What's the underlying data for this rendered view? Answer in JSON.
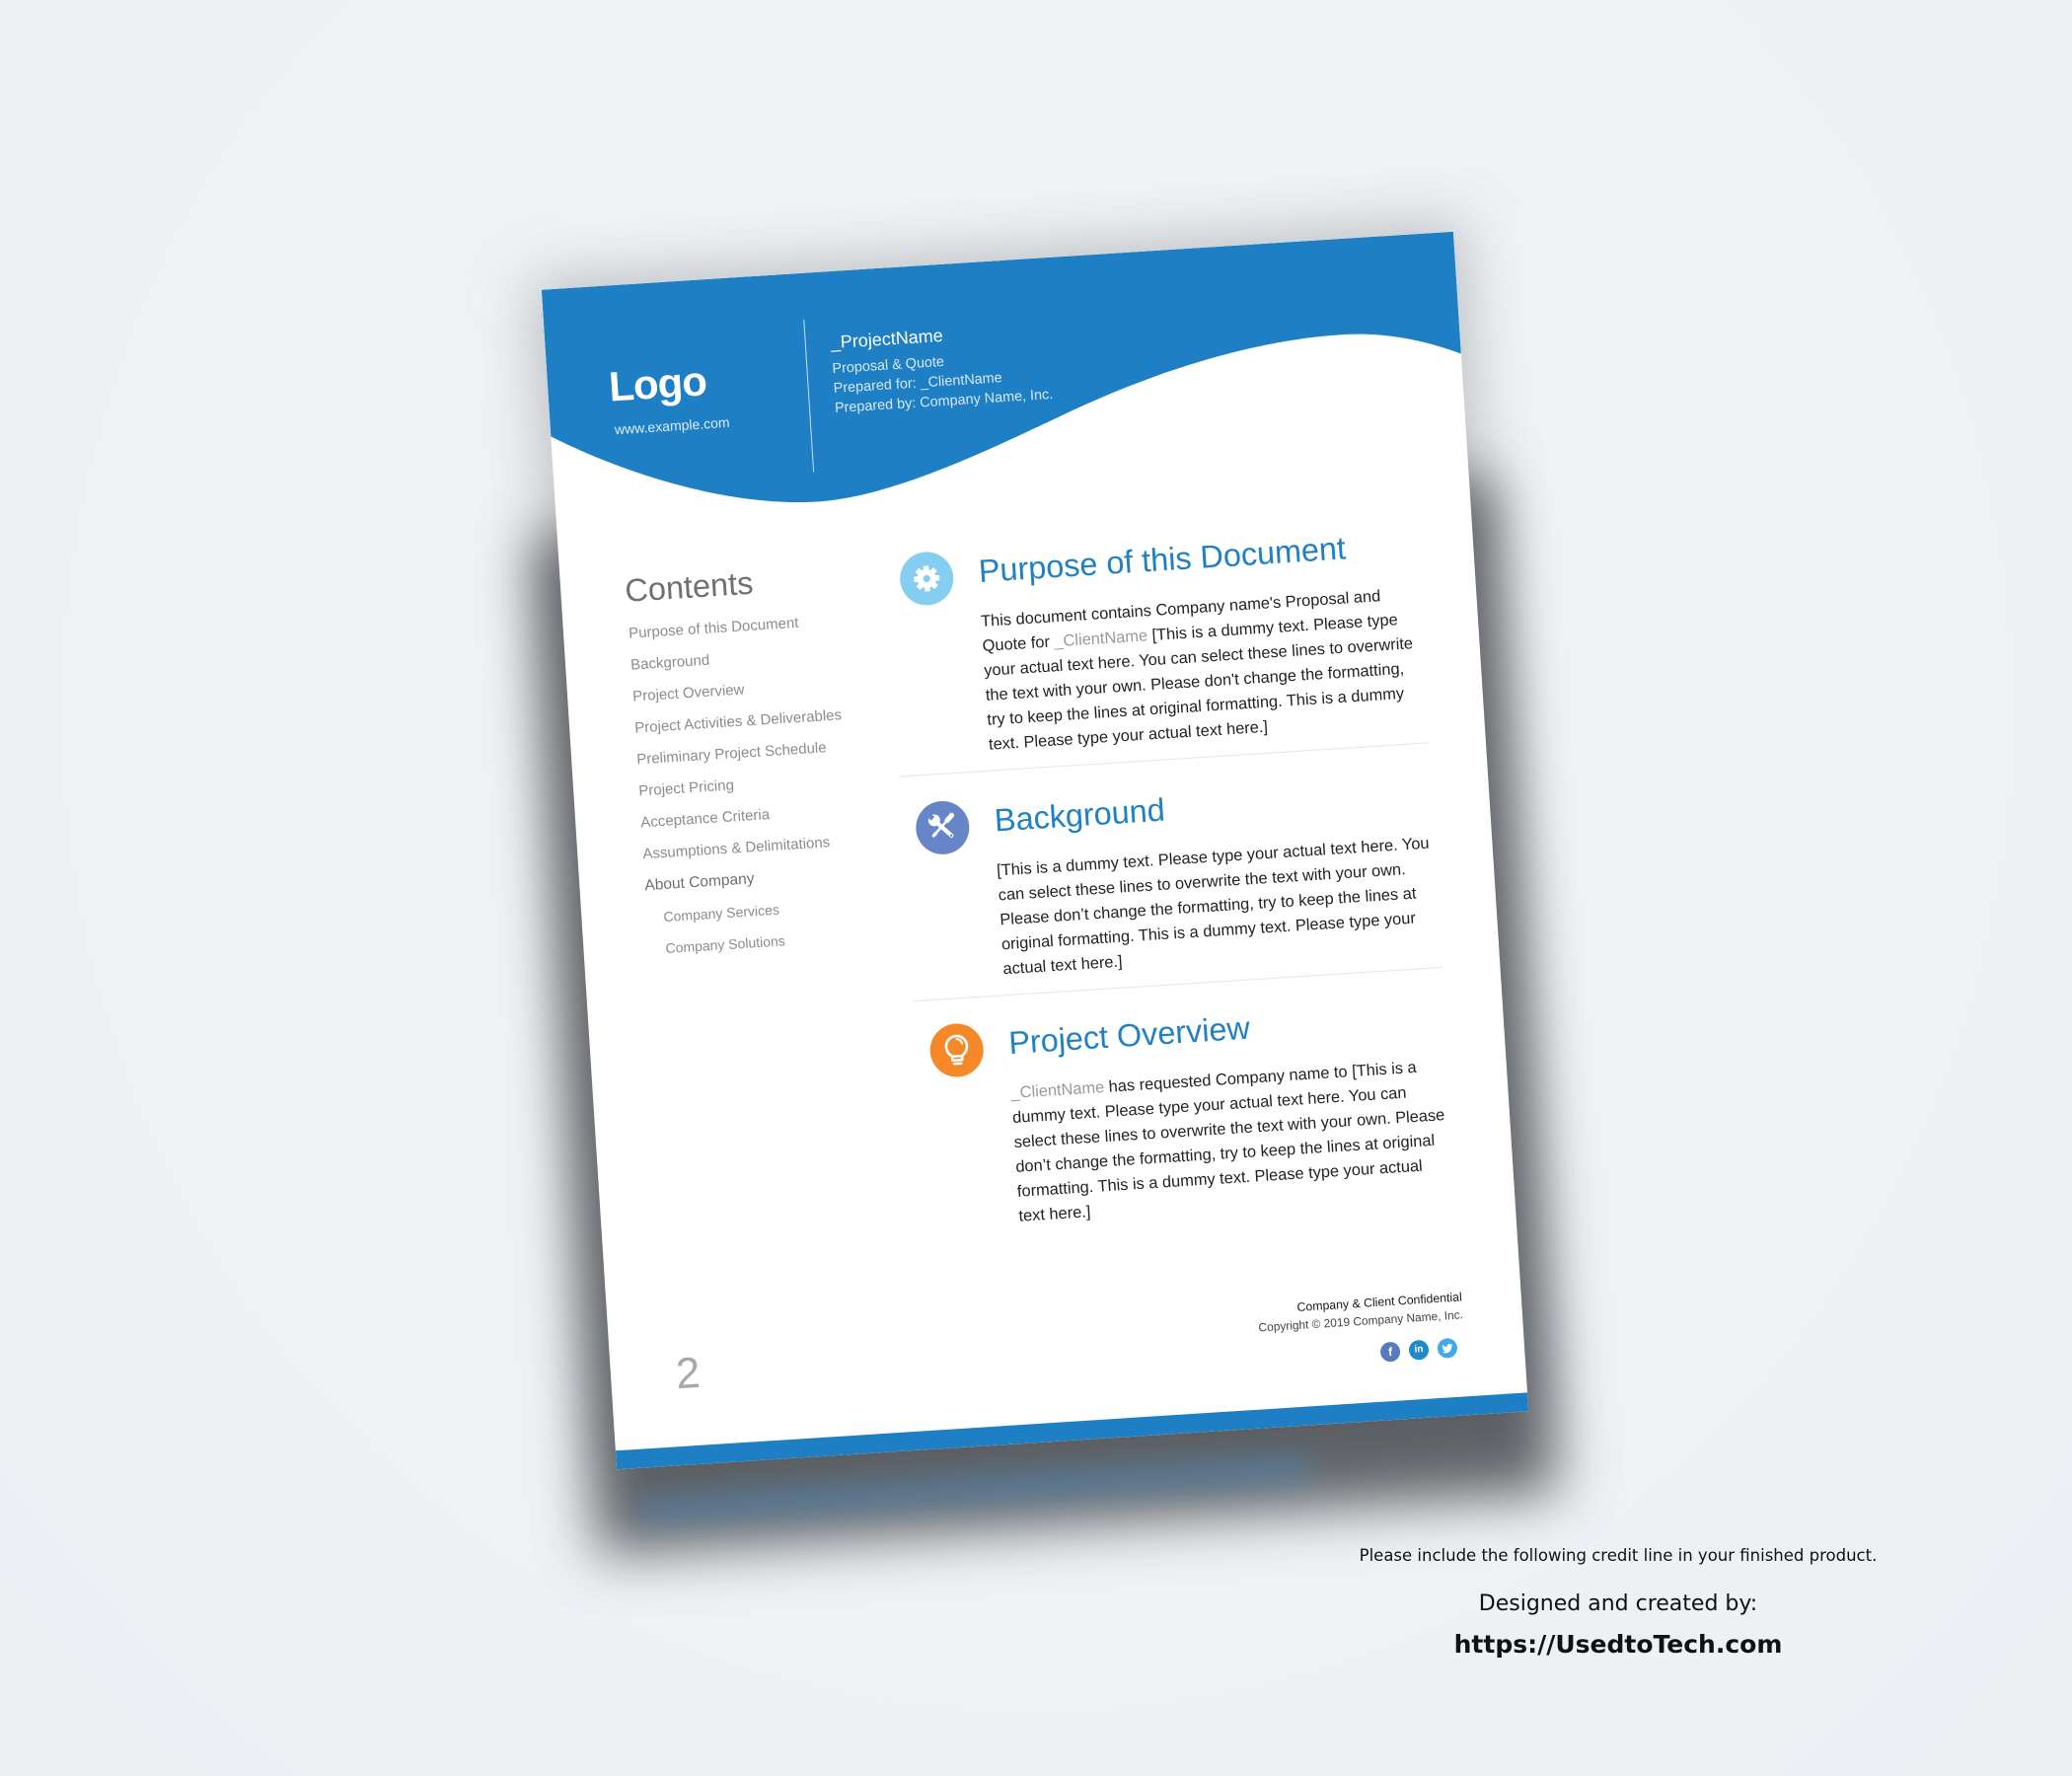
{
  "colors": {
    "brand_blue": "#1f7fc4",
    "heading_blue": "#2080c6"
  },
  "header": {
    "logo": "Logo",
    "website": "www.example.com",
    "project_name": "_ProjectName",
    "subtitle": "Proposal & Quote",
    "prepared_for": "Prepared for: _ClientName",
    "prepared_by": "Prepared by: Company Name, Inc."
  },
  "contents": {
    "title": "Contents",
    "items": [
      {
        "label": "Purpose of this Document",
        "level": 1
      },
      {
        "label": "Background",
        "level": 1
      },
      {
        "label": "Project Overview",
        "level": 1
      },
      {
        "label": "Project Activities & Deliverables",
        "level": 1
      },
      {
        "label": "Preliminary Project Schedule",
        "level": 1
      },
      {
        "label": "Project Pricing",
        "level": 1
      },
      {
        "label": "Acceptance Criteria",
        "level": 1
      },
      {
        "label": "Assumptions & Delimitations",
        "level": 1
      },
      {
        "label": "About Company",
        "level": 1
      },
      {
        "label": "Company Services",
        "level": 2
      },
      {
        "label": "Company Solutions",
        "level": 2
      }
    ]
  },
  "sections": [
    {
      "icon": "gear-icon",
      "icon_color": "#86cef1",
      "title": "Purpose of this Document",
      "lines": [
        [
          {
            "text": "This document contains Company name's Proposal and"
          }
        ],
        [
          {
            "text": "Quote for "
          },
          {
            "text": "_ClientName",
            "style": "muted"
          },
          {
            "text": " [This is a dummy text. Please type"
          }
        ],
        [
          {
            "text": "your actual text here. You can select these lines to overwrite"
          }
        ],
        [
          {
            "text": "the text with your own. Please don't change the formatting,"
          }
        ],
        [
          {
            "text": "try to keep the lines at original formatting. This is a dummy"
          }
        ],
        [
          {
            "text": "text. Please type your actual text here.]"
          }
        ]
      ]
    },
    {
      "icon": "tools-icon",
      "icon_color": "#6686c8",
      "title": "Background",
      "lines": [
        [
          {
            "text": "[This is a dummy text. Please type your actual text here. You"
          }
        ],
        [
          {
            "text": "can select these lines to overwrite the text with your own."
          }
        ],
        [
          {
            "text": "Please don’t change the formatting, try to keep the lines at"
          }
        ],
        [
          {
            "text": "original formatting. This is a dummy text. Please type your"
          }
        ],
        [
          {
            "text": "actual text here.]"
          }
        ]
      ]
    },
    {
      "icon": "lightbulb-icon",
      "icon_color": "#f5892a",
      "title": "Project Overview",
      "lines": [
        [
          {
            "text": "_ClientName",
            "style": "muted"
          },
          {
            "text": " has requested Company name to [This is a"
          }
        ],
        [
          {
            "text": "dummy text. Please type your actual text here. You can"
          }
        ],
        [
          {
            "text": "select these lines to overwrite the text with your own. Please"
          }
        ],
        [
          {
            "text": "don’t change the formatting, try to keep the lines at original"
          }
        ],
        [
          {
            "text": "formatting. This is a dummy text. Please type your actual"
          }
        ],
        [
          {
            "text": "text here.]"
          }
        ]
      ]
    }
  ],
  "footer": {
    "confidential": "Company & Client Confidential",
    "copyright": "Copyright © 2019 Company Name, Inc.",
    "page_number": "2",
    "social": [
      {
        "name": "facebook",
        "glyph": "f",
        "color": "#5a7abf"
      },
      {
        "name": "linkedin",
        "glyph": "in",
        "color": "#1f8ac9"
      },
      {
        "name": "twitter",
        "glyph": "",
        "color": "#41a9e8"
      }
    ]
  },
  "credit": {
    "note": "Please include the following credit line in your finished product.",
    "designed_by": "Designed and created by:",
    "url": "https://UsedtoTech.com"
  }
}
